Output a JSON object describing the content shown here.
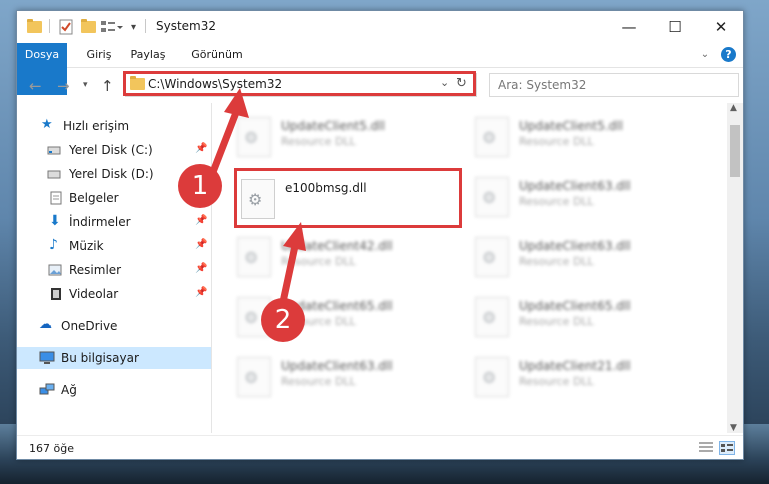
{
  "window": {
    "title": "System32",
    "controls": {
      "minimize": "—",
      "maximize": "☐",
      "close": "✕"
    }
  },
  "ribbon": {
    "tabs": [
      "Dosya",
      "Giriş",
      "Paylaş",
      "Görünüm"
    ],
    "help": "?"
  },
  "navigation": {
    "address": "C:\\Windows\\System32",
    "search_placeholder": "Ara: System32"
  },
  "sidebar": {
    "items": [
      {
        "label": "Hızlı erişim",
        "icon": "star-icon"
      },
      {
        "label": "Yerel Disk (C:)",
        "icon": "drive-icon"
      },
      {
        "label": "Yerel Disk (D:)",
        "icon": "drive-icon"
      },
      {
        "label": "Belgeler",
        "icon": "document-icon"
      },
      {
        "label": "İndirmeler",
        "icon": "download-icon"
      },
      {
        "label": "Müzik",
        "icon": "music-icon"
      },
      {
        "label": "Resimler",
        "icon": "picture-icon"
      },
      {
        "label": "Videolar",
        "icon": "video-icon"
      },
      {
        "label": "OneDrive",
        "icon": "cloud-icon"
      },
      {
        "label": "Bu bilgisayar",
        "icon": "computer-icon"
      },
      {
        "label": "Ağ",
        "icon": "network-icon"
      }
    ]
  },
  "files": [
    {
      "name": "UpdateClient5.dll",
      "type": "Resource DLL"
    },
    {
      "name": "UpdateClient5.dll",
      "type": "Resource DLL"
    },
    {
      "name": "e100bmsg.dll",
      "type": ""
    },
    {
      "name": "UpdateClient63.dll",
      "type": "Resource DLL"
    },
    {
      "name": "UpdateClient42.dll",
      "type": "Resource DLL"
    },
    {
      "name": "UpdateClient63.dll",
      "type": "Resource DLL"
    },
    {
      "name": "UpdateClient65.dll",
      "type": "Resource DLL"
    },
    {
      "name": "UpdateClient65.dll",
      "type": "Resource DLL"
    },
    {
      "name": "UpdateClient63.dll",
      "type": "Resource DLL"
    },
    {
      "name": "UpdateClient21.dll",
      "type": "Resource DLL"
    }
  ],
  "status": {
    "count": "167 öğe"
  },
  "annotations": {
    "step1": "1",
    "step2": "2"
  },
  "colors": {
    "accent": "#1979ca",
    "highlight": "#dc3b3b",
    "selection": "#cce8ff"
  }
}
